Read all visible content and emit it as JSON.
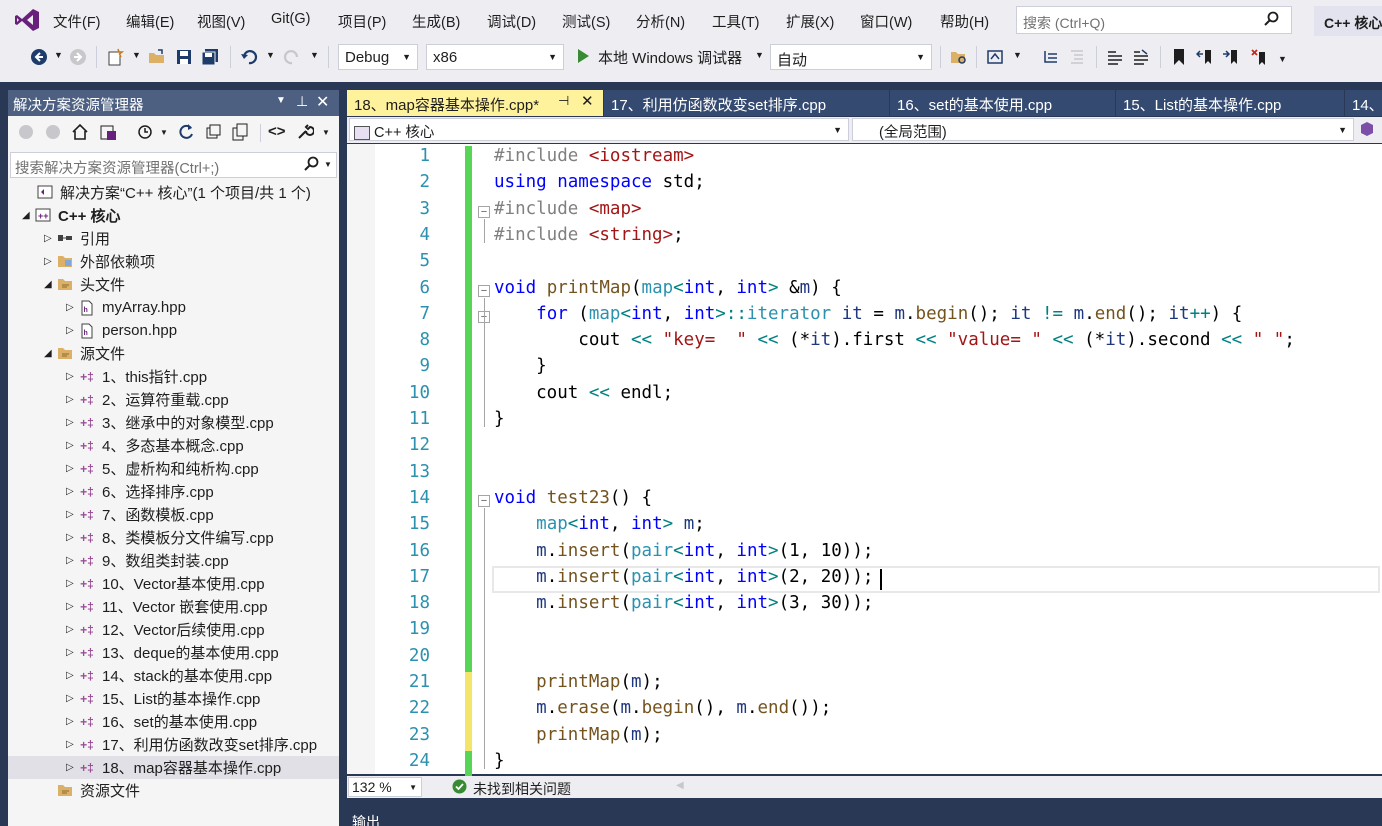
{
  "menu": {
    "items": [
      "文件(F)",
      "编辑(E)",
      "视图(V)",
      "Git(G)",
      "项目(P)",
      "生成(B)",
      "调试(D)",
      "测试(S)",
      "分析(N)",
      "工具(T)",
      "扩展(X)",
      "窗口(W)",
      "帮助(H)"
    ],
    "search_placeholder": "搜索 (Ctrl+Q)",
    "solution_badge": "C++ 核心"
  },
  "toolbar": {
    "config": "Debug",
    "platform": "x86",
    "debugger_label": "本地 Windows 调试器",
    "auto_label": "自动"
  },
  "solution_explorer": {
    "title": "解决方案资源管理器",
    "search_placeholder": "搜索解决方案资源管理器(Ctrl+;)",
    "solution": "解决方案“C++ 核心”(1 个项目/共 1 个)",
    "project": "C++ 核心",
    "references": "引用",
    "external_deps": "外部依赖项",
    "headers_folder": "头文件",
    "headers": [
      "myArray.hpp",
      "person.hpp"
    ],
    "sources_folder": "源文件",
    "sources": [
      "1、this指针.cpp",
      "2、运算符重载.cpp",
      "3、继承中的对象模型.cpp",
      "4、多态基本概念.cpp",
      "5、虚析构和纯析构.cpp",
      "6、选择排序.cpp",
      "7、函数模板.cpp",
      "8、类模板分文件编写.cpp",
      "9、数组类封装.cpp",
      "10、Vector基本使用.cpp",
      "11、Vector 嵌套使用.cpp",
      "12、Vector后续使用.cpp",
      "13、deque的基本使用.cpp",
      "14、stack的基本使用.cpp",
      "15、List的基本操作.cpp",
      "16、set的基本使用.cpp",
      "17、利用仿函数改变set排序.cpp",
      "18、map容器基本操作.cpp"
    ],
    "resources_folder": "资源文件"
  },
  "tabs": [
    {
      "label": "18、map容器基本操作.cpp*",
      "active": true
    },
    {
      "label": "17、利用仿函数改变set排序.cpp",
      "active": false
    },
    {
      "label": "16、set的基本使用.cpp",
      "active": false
    },
    {
      "label": "15、List的基本操作.cpp",
      "active": false
    },
    {
      "label": "14、",
      "active": false
    }
  ],
  "navbar": {
    "project_scope": "C++ 核心",
    "global_scope": "(全局范围)"
  },
  "editor": {
    "line_numbers": [
      "1",
      "2",
      "3",
      "4",
      "5",
      "6",
      "7",
      "8",
      "9",
      "10",
      "11",
      "12",
      "13",
      "14",
      "15",
      "16",
      "17",
      "18",
      "19",
      "20",
      "21",
      "22",
      "23",
      "24"
    ],
    "lines": [
      "#include <iostream>",
      "using namespace std;",
      "#include <map>",
      "#include <string>;",
      "",
      "void printMap(map<int, int> &m) {",
      "    for (map<int, int>::iterator it = m.begin(); it != m.end(); it++) {",
      "        cout << \"key=  \" << (*it).first << \"value= \" << (*it).second << \" \";",
      "    }",
      "    cout << endl;",
      "}",
      "",
      "",
      "void test23() {",
      "    map<int, int> m;",
      "    m.insert(pair<int, int>(1, 10));",
      "    m.insert(pair<int, int>(2, 20));",
      "    m.insert(pair<int, int>(3, 30));",
      "",
      "",
      "    printMap(m);",
      "    m.erase(m.begin(), m.end());",
      "    printMap(m);",
      "}"
    ],
    "change_colors": {
      "saved": "#57D557",
      "unsaved": "#F3E56A"
    }
  },
  "status": {
    "zoom": "132 %",
    "issues": "未找到相关问题"
  },
  "output": {
    "title": "输出"
  }
}
